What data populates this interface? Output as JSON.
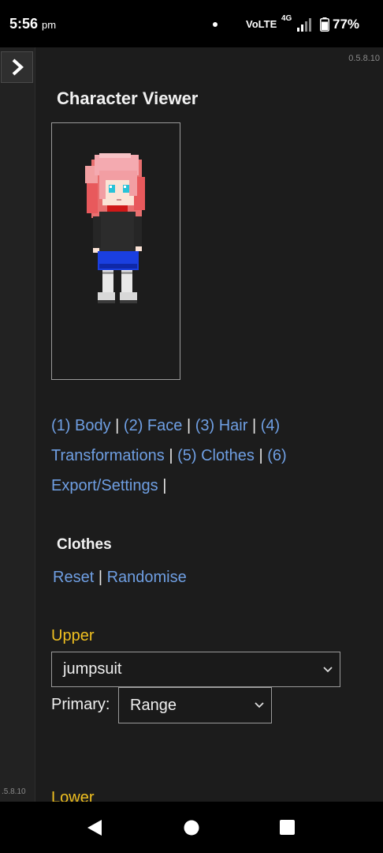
{
  "status_bar": {
    "time": "5:56",
    "ampm": "pm",
    "carrier": "VoLTE",
    "network": "4G",
    "battery_pct": "77%"
  },
  "sidebar": {
    "toggle_icon": "chevron-right-icon",
    "version": ".5.8.10"
  },
  "header": {
    "version": "0.5.8.10",
    "title": "Character Viewer"
  },
  "nav_links": [
    {
      "label": "(1) Body"
    },
    {
      "label": "(2) Face"
    },
    {
      "label": "(3) Hair"
    },
    {
      "label": "(4) Transformations"
    },
    {
      "label": "(5) Clothes"
    },
    {
      "label": "(6) Export/Settings"
    }
  ],
  "separator": "|",
  "clothes": {
    "title": "Clothes",
    "reset_label": "Reset",
    "randomise_label": "Randomise",
    "upper": {
      "label": "Upper",
      "value": "jumpsuit",
      "primary_label": "Primary:",
      "primary_value": "Range"
    },
    "lower": {
      "label": "Lower"
    }
  },
  "colors": {
    "link": "#6f9fe3",
    "field_label": "#f0c020",
    "background": "#1c1c1c"
  }
}
